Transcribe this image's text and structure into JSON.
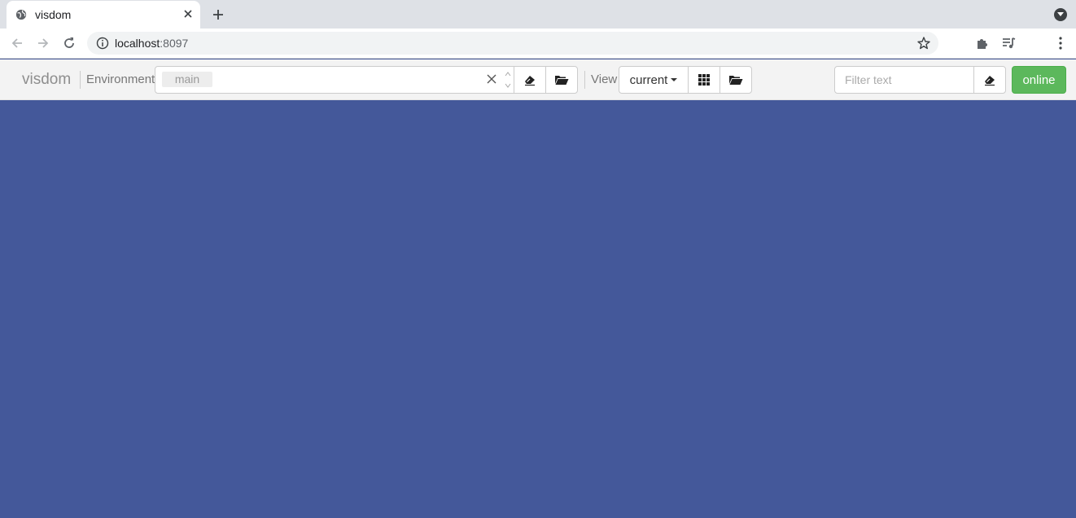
{
  "browser": {
    "tab_title": "visdom",
    "url_host": "localhost",
    "url_port": ":8097"
  },
  "visdom": {
    "brand": "visdom",
    "environment_label": "Environment",
    "environment_selected": "main",
    "view_label": "View",
    "view_selected": "current",
    "filter_placeholder": "Filter text",
    "status": "online"
  },
  "colors": {
    "workspace_bg": "#44589a",
    "online_green": "#5cb85c",
    "navbar_bg": "#f3f3f3"
  },
  "icons": {
    "tab_favicon": "globe-icon",
    "close": "close-icon",
    "new_tab": "plus-icon",
    "back": "arrow-left-icon",
    "forward": "arrow-right-icon",
    "reload": "reload-icon",
    "info": "info-icon",
    "bookmark": "star-icon",
    "extensions": "puzzle-icon",
    "media": "playlist-icon",
    "menu": "kebab-menu-icon",
    "eraser": "eraser-icon",
    "folder": "folder-open-icon",
    "grid": "grid-icon"
  }
}
